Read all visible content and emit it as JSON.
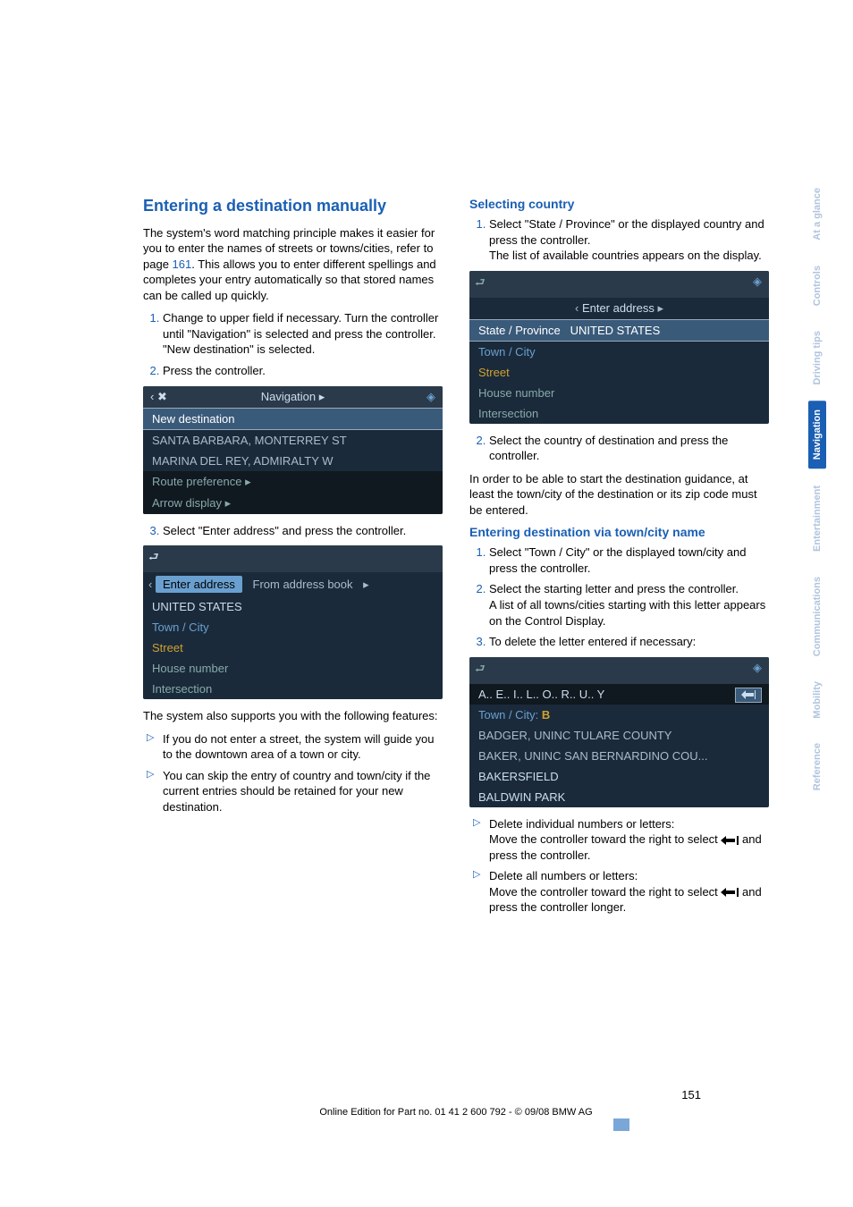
{
  "page_number": "151",
  "footer": "Online Edition for Part no. 01 41 2 600 792 - © 09/08 BMW AG",
  "side_tabs": [
    "At a glance",
    "Controls",
    "Driving tips",
    "Navigation",
    "Entertainment",
    "Communications",
    "Mobility",
    "Reference"
  ],
  "active_tab_index": 3,
  "left": {
    "title": "Entering a destination manually",
    "intro_a": "The system's word matching principle makes it easier for you to enter the names of streets or towns/cities, refer to page ",
    "intro_xref": "161",
    "intro_b": ". This allows you to enter different spellings and completes your entry automatically so that stored names can be called up quickly.",
    "step1_a": "Change to upper field if necessary. Turn the controller until \"Navigation\" is selected and press the controller.",
    "step1_b": "\"New destination\" is selected.",
    "step2": "Press the controller.",
    "shot1": {
      "header": "Navigation",
      "row_sel": "New destination",
      "row2": "SANTA BARBARA, MONTERREY ST",
      "row3": "MARINA DEL REY, ADMIRALTY W",
      "row4": "Route preference ▸",
      "row5": "Arrow display ▸"
    },
    "step3": "Select \"Enter address\" and press the controller.",
    "shot2": {
      "tab1": "Enter address",
      "tab2": "From address book",
      "row1": "UNITED STATES",
      "row2": "Town / City",
      "row3": "Street",
      "row4": "House number",
      "row5": "Intersection"
    },
    "support_intro": "The system also supports you with the following features:",
    "bullet1": "If you do not enter a street, the system will guide you to the downtown area of a town or city.",
    "bullet2": "You can skip the entry of country and town/city if the current entries should be retained for your new destination."
  },
  "right": {
    "h_country": "Selecting country",
    "country_step1_a": "Select \"State / Province\" or the displayed country and press the controller.",
    "country_step1_b": "The list of available countries appears on the display.",
    "shot3": {
      "header": "Enter address",
      "row_sel_label": "State / Province",
      "row_sel_value": "UNITED STATES",
      "row2": "Town / City",
      "row3": "Street",
      "row4": "House number",
      "row5": "Intersection"
    },
    "country_step2": "Select the country of destination and press the controller.",
    "country_note": "In order to be able to start the destination guidance, at least the town/city of the destination or its zip code must be entered.",
    "h_town": "Entering destination via town/city name",
    "town_step1": "Select \"Town / City\" or the displayed town/city and press the controller.",
    "town_step2a": "Select the starting letter and press the controller.",
    "town_step2b": "A list of all towns/cities starting with this letter appears on the Control Display.",
    "town_step3": "To delete the letter entered if necessary:",
    "shot4": {
      "input": "A.. E.. I.. L.. O.. R.. U.. Y",
      "label": "Town / City:",
      "letter": "B",
      "row1": "BADGER, UNINC TULARE COUNTY",
      "row2": "BAKER, UNINC SAN BERNARDINO COU...",
      "row3": "BAKERSFIELD",
      "row4": "BALDWIN PARK"
    },
    "del_bullet1_a": "Delete individual numbers or letters:",
    "del_bullet1_b": "Move the controller toward the right to select ",
    "del_bullet1_c": " and press the controller.",
    "del_bullet2_a": "Delete all numbers or letters:",
    "del_bullet2_b": "Move the controller toward the right to select ",
    "del_bullet2_c": " and press the controller longer."
  }
}
